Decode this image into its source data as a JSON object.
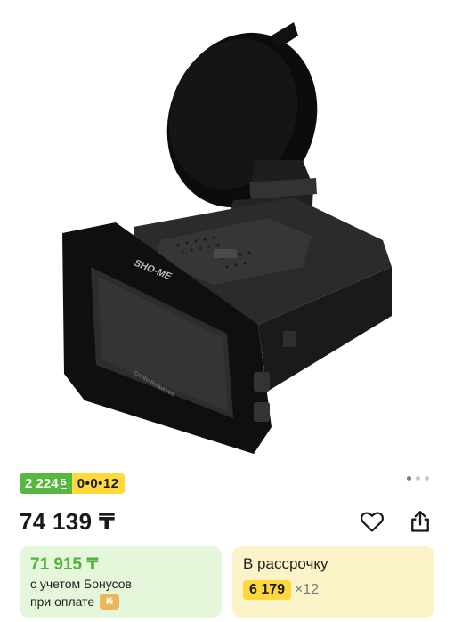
{
  "product_image": {
    "alt": "",
    "brand_text": "SHO-ME",
    "model_text": "Combo Rocket Wifi"
  },
  "carousel": {
    "total": 3,
    "active": 1
  },
  "badges": {
    "bonus": "2 224",
    "bonus_currency": "Б",
    "installment": "0•0•12"
  },
  "price": "74 139 ₸",
  "actions": {
    "favorite_icon": "heart-icon",
    "share_icon": "share-icon"
  },
  "bonus_card": {
    "price": "71 915 ₸",
    "line1": "с учетом Бонусов",
    "line2": "при оплате",
    "pay_icon": "kaspi-icon"
  },
  "installment_card": {
    "title": "В рассрочку",
    "monthly": "6 179",
    "months": "×12"
  },
  "colors": {
    "green": "#57b840",
    "yellow": "#ffd83b",
    "green_bg": "#e6f6db",
    "yellow_bg": "#fdf3c8"
  }
}
